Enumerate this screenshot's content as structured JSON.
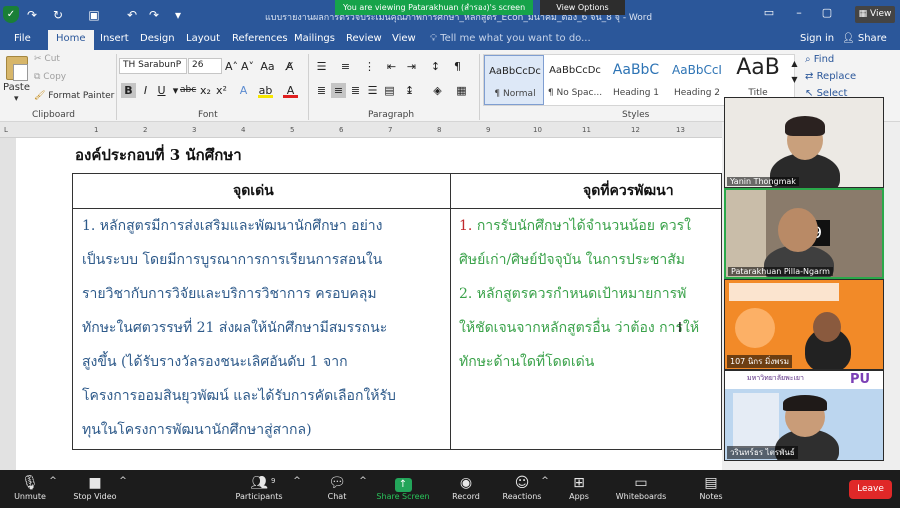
{
  "titlebar": {
    "doc_title": "แบบรายงานผลการตรวจประเมินคุณภาพการศึกษา_หลักสูตร_Econ_มีนาคม_ต่อง_6 จน_8 จุ - Word",
    "share_banner": "You are viewing Patarakhuan (สำรอง)'s screen",
    "view_options": "View Options",
    "view_button": "View"
  },
  "ribbon_tabs": [
    "File",
    "Home",
    "Insert",
    "Design",
    "Layout",
    "References",
    "Mailings",
    "Review",
    "View"
  ],
  "tell_me": "Tell me what you want to do...",
  "sign_in": "Sign in",
  "share": "Share",
  "clipboard": {
    "paste": "Paste",
    "cut": "Cut",
    "copy": "Copy",
    "format_painter": "Format Painter",
    "group_label": "Clipboard"
  },
  "font": {
    "name": "TH SarabunP",
    "size": "26",
    "group_label": "Font"
  },
  "paragraph_label": "Paragraph",
  "styles": {
    "group_label": "Styles",
    "items": [
      {
        "sample": "AaBbCcDc",
        "name": "¶ Normal"
      },
      {
        "sample": "AaBbCcDc",
        "name": "¶ No Spac..."
      },
      {
        "sample": "AaBbC",
        "name": "Heading 1"
      },
      {
        "sample": "AaBbCcI",
        "name": "Heading 2"
      },
      {
        "sample": "AaB",
        "name": "Title"
      }
    ]
  },
  "editing": {
    "find": "Find",
    "replace": "Replace",
    "select": "Select"
  },
  "ruler_ticks": [
    "1",
    "2",
    "3",
    "4",
    "5",
    "6",
    "7",
    "8",
    "9",
    "10",
    "11",
    "12",
    "13"
  ],
  "document": {
    "heading": "องค์ประกอบที่ 3 นักศึกษา",
    "col1_header": "จุดเด่น",
    "col2_header": "จุดที่ควรพัฒนา",
    "col1_lines": [
      "1. หลักสูตรมีการส่งเสริมและพัฒนานักศึกษา อย่าง",
      "เป็นระบบ โดยมีการบูรณาการการเรียนการสอนใน",
      "รายวิชากับการวิจัยและบริการวิชาการ ครอบคลุม",
      "ทักษะในศตวรรษที่ 21 ส่งผลให้นักศึกษามีสมรรถนะ",
      "สูงขึ้น (ได้รับรางวัลรองชนะเลิศอันดับ 1 จาก",
      "โครงการออมสินยุวพัฒน์ และได้รับการคัดเลือกให้รับ",
      "ทุนในโครงการพัฒนานักศึกษาสู่สากล)"
    ],
    "col2_item1_num": "1.",
    "col2_item1_line1": "การรับนักศึกษาได้จำนวนน้อย ควรใ",
    "col2_item1_line2": "ศิษย์เก่า/ศิษย์ปัจจุบัน ในการประชาสัม",
    "col2_item2_lines": [
      "2. หลักสูตรควรกำหนดเป้าหมายการพั",
      "ให้ชัดเจนจากหลักสูตรอื่น ว่าต้อง การให้",
      "ทักษะด้านใดที่โดดเด่น"
    ]
  },
  "participants": [
    {
      "name": "Yanin Thongmak"
    },
    {
      "name": "Patarakhuan Pilla-Ngarm"
    },
    {
      "name": "107 นิกร มิ่งพรม"
    },
    {
      "name": "วรินทร์ธร ไตรพันธ์"
    }
  ],
  "tile_text": {
    "video_digit": "9",
    "banner_pu": "PU",
    "university": "มหาวิทยาลัยพะเยา"
  },
  "toolbar": {
    "unmute": "Unmute",
    "stop_video": "Stop Video",
    "participants": "Participants",
    "participant_count": "9",
    "chat": "Chat",
    "share_screen": "Share Screen",
    "record": "Record",
    "reactions": "Reactions",
    "apps": "Apps",
    "whiteboards": "Whiteboards",
    "notes": "Notes",
    "leave": "Leave"
  },
  "colors": {
    "word_blue": "#2b579a",
    "text_blue": "#2e5a8a",
    "text_green": "#3aa24a",
    "text_red": "#c0282d",
    "zoom_green": "#23a55a",
    "leave_red": "#e02828"
  }
}
